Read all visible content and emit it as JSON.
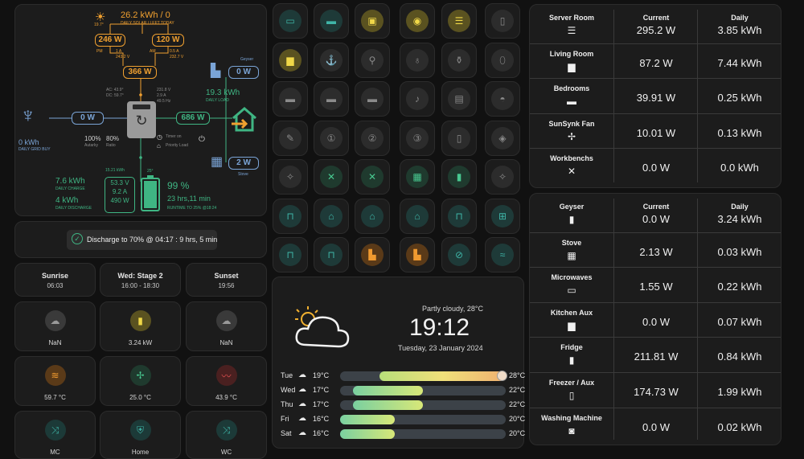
{
  "flow": {
    "solar": {
      "total": "26.2 kWh / 0",
      "caption": "DAILY SOLAR / LEFT TODAY",
      "temp": "19.7°"
    },
    "pv_pm": {
      "power": "246 W",
      "label": "PM",
      "amps": "1 A",
      "volts": "243.2 V"
    },
    "pv_am": {
      "power": "120 W",
      "label": "AM",
      "amps": "0.5 A",
      "volts": "232.7 V"
    },
    "pv_total": "366 W",
    "inverter": {
      "ac": "AC: 43.9°",
      "dc": "DC: 59.7°",
      "volts": "231.8 V",
      "amps": "2.9 A",
      "freq": "49.5 Hz"
    },
    "grid": {
      "power": "0 W",
      "energy": "0 kWh",
      "caption": "DAILY GRID BUY",
      "autarky_val": "100%",
      "autarky": "Autarky",
      "ratio_val": "80%",
      "ratio": "Ratio"
    },
    "load": {
      "power": "686 W",
      "energy": "19.3 kWh",
      "caption": "DAILY LOAD"
    },
    "geyser": {
      "label": "Geyser",
      "power": "0 W"
    },
    "stove": {
      "label": "Stove",
      "power": "2 W"
    },
    "timer": "Timer on",
    "priority": "Priority Load",
    "battery": {
      "energy_kwh": "15.21 kWh",
      "charge": "7.6 kWh",
      "charge_caption": "DAILY CHARGE",
      "discharge": "4 kWh",
      "discharge_caption": "DAILY DISCHARGE",
      "volts": "53.3 V",
      "amps": "9.2 A",
      "power": "490 W",
      "temp": "25°",
      "soc": "99 %",
      "runtime": "23 hrs,11 min",
      "runtime_caption": "RUNTIME TO 25% @18:24",
      "soc_fraction": 0.99
    }
  },
  "discharge_note": "Discharge to 70% @ 04:17 : 9 hrs, 5 min",
  "sun_tiles": [
    {
      "title": "Sunrise",
      "value": "06:03"
    },
    {
      "title": "Wed: Stage 2",
      "value": "16:00 - 18:30"
    },
    {
      "title": "Sunset",
      "value": "19:56"
    }
  ],
  "sensor_tiles": [
    {
      "label": "NaN",
      "icon": "weather-icon",
      "color": "#3a3a3a",
      "fg": "#9a9a9a",
      "glyph": "☁"
    },
    {
      "label": "3.24 kW",
      "icon": "geyser-icon",
      "color": "#5a5220",
      "fg": "#f0d848",
      "glyph": "▮"
    },
    {
      "label": "NaN",
      "icon": "weather-icon",
      "color": "#3a3a3a",
      "fg": "#9a9a9a",
      "glyph": "☁"
    },
    {
      "label": "59.7 °C",
      "icon": "heater-icon",
      "color": "#5a3a18",
      "fg": "#f09a30",
      "glyph": "≋"
    },
    {
      "label": "25.0 °C",
      "icon": "fan-icon",
      "color": "#1f3a2e",
      "fg": "#48c890",
      "glyph": "✢"
    },
    {
      "label": "43.9 °C",
      "icon": "thermometer-icon",
      "color": "#4a2020",
      "fg": "#e05050",
      "glyph": "〰"
    },
    {
      "label": "MC",
      "icon": "motion-icon",
      "color": "#1c3a38",
      "fg": "#3fb5a8",
      "glyph": "⤨"
    },
    {
      "label": "Home",
      "icon": "shield-home-icon",
      "color": "#1c3a38",
      "fg": "#3fb5a8",
      "glyph": "⛨"
    },
    {
      "label": "WC",
      "icon": "motion-icon",
      "color": "#1c3a38",
      "fg": "#3fb5a8",
      "glyph": "⤨"
    }
  ],
  "buttons": [
    [
      {
        "name": "tv-icon",
        "bg": "#1e3a38",
        "fg": "#3fb5a8",
        "glyph": "▭"
      },
      {
        "name": "soundbar-icon",
        "bg": "#1e3a38",
        "fg": "#3fb5a8",
        "glyph": "▬"
      },
      {
        "name": "laptop-icon",
        "bg": "#5a5220",
        "fg": "#f0d848",
        "glyph": "▣"
      },
      {
        "name": "speaker-icon",
        "bg": "#5a5220",
        "fg": "#f0d848",
        "glyph": "◉"
      },
      {
        "name": "server-icon",
        "bg": "#5a5220",
        "fg": "#f0d848",
        "glyph": "☰"
      },
      {
        "name": "phone-icon",
        "bg": "#2c2c2c",
        "fg": "#8a8a8a",
        "glyph": "▯"
      }
    ],
    [
      {
        "name": "sofa-icon",
        "bg": "#5a5220",
        "fg": "#f0d848",
        "glyph": "▆"
      },
      {
        "name": "ceiling-light-icon",
        "bg": "#2c2c2c",
        "fg": "#8a8a8a",
        "glyph": "⚓"
      },
      {
        "name": "lamp-icon",
        "bg": "#2c2c2c",
        "fg": "#8a8a8a",
        "glyph": "⚲"
      },
      {
        "name": "pendant-light-icon",
        "bg": "#2c2c2c",
        "fg": "#8a8a8a",
        "glyph": "♁"
      },
      {
        "name": "lamp-icon",
        "bg": "#2c2c2c",
        "fg": "#8a8a8a",
        "glyph": "⚱"
      },
      {
        "name": "capsule-light-icon",
        "bg": "#2c2c2c",
        "fg": "#8a8a8a",
        "glyph": "⬯"
      }
    ],
    [
      {
        "name": "bed-icon",
        "bg": "#2c2c2c",
        "fg": "#8a8a8a",
        "glyph": "▬"
      },
      {
        "name": "bed-icon",
        "bg": "#2c2c2c",
        "fg": "#8a8a8a",
        "glyph": "▬"
      },
      {
        "name": "bed-icon",
        "bg": "#2c2c2c",
        "fg": "#8a8a8a",
        "glyph": "▬"
      },
      {
        "name": "bell-icon",
        "bg": "#2c2c2c",
        "fg": "#8a8a8a",
        "glyph": "♪"
      },
      {
        "name": "heater-icon",
        "bg": "#2c2c2c",
        "fg": "#8a8a8a",
        "glyph": "▤"
      },
      {
        "name": "bathtub-icon",
        "bg": "#2c2c2c",
        "fg": "#8a8a8a",
        "glyph": "◓"
      }
    ],
    [
      {
        "name": "light-switch-icon",
        "bg": "#2c2c2c",
        "fg": "#8a8a8a",
        "glyph": "✎"
      },
      {
        "name": "number-1-icon",
        "bg": "#2c2c2c",
        "fg": "#8a8a8a",
        "glyph": "①"
      },
      {
        "name": "number-2-icon",
        "bg": "#2c2c2c",
        "fg": "#8a8a8a",
        "glyph": "②"
      },
      {
        "name": "number-3-icon",
        "bg": "#2c2c2c",
        "fg": "#8a8a8a",
        "glyph": "③"
      },
      {
        "name": "tablet-icon",
        "bg": "#2c2c2c",
        "fg": "#8a8a8a",
        "glyph": "▯"
      },
      {
        "name": "alarm-light-icon",
        "bg": "#2c2c2c",
        "fg": "#8a8a8a",
        "glyph": "◈"
      }
    ],
    [
      {
        "name": "lamp-off-icon",
        "bg": "#2c2c2c",
        "fg": "#8a8a8a",
        "glyph": "✧"
      },
      {
        "name": "tools-icon",
        "bg": "#1f3a2e",
        "fg": "#48c890",
        "glyph": "✕"
      },
      {
        "name": "tools-icon",
        "bg": "#1f3a2e",
        "fg": "#48c890",
        "glyph": "✕"
      },
      {
        "name": "calendar-icon",
        "bg": "#1f3a2e",
        "fg": "#48c890",
        "glyph": "▦"
      },
      {
        "name": "fridge-icon",
        "bg": "#1f3a2e",
        "fg": "#48c890",
        "glyph": "▮"
      },
      {
        "name": "lamp-off-icon",
        "bg": "#2c2c2c",
        "fg": "#8a8a8a",
        "glyph": "✧"
      }
    ],
    [
      {
        "name": "door-icon",
        "bg": "#1e3a38",
        "fg": "#3fb5a8",
        "glyph": "⊓"
      },
      {
        "name": "garage-icon",
        "bg": "#1e3a38",
        "fg": "#3fb5a8",
        "glyph": "⌂"
      },
      {
        "name": "garage-icon",
        "bg": "#1e3a38",
        "fg": "#3fb5a8",
        "glyph": "⌂"
      },
      {
        "name": "garage-icon",
        "bg": "#1e3a38",
        "fg": "#3fb5a8",
        "glyph": "⌂"
      },
      {
        "name": "door-icon",
        "bg": "#1e3a38",
        "fg": "#3fb5a8",
        "glyph": "⊓"
      },
      {
        "name": "gate-icon",
        "bg": "#1e3a38",
        "fg": "#3fb5a8",
        "glyph": "⊞"
      }
    ],
    [
      {
        "name": "door-icon",
        "bg": "#1e3a38",
        "fg": "#3fb5a8",
        "glyph": "⊓"
      },
      {
        "name": "door-icon",
        "bg": "#1e3a38",
        "fg": "#3fb5a8",
        "glyph": "⊓"
      },
      {
        "name": "door-open-icon",
        "bg": "#5a3a18",
        "fg": "#f09a30",
        "glyph": "▙"
      },
      {
        "name": "door-open-icon",
        "bg": "#5a3a18",
        "fg": "#f09a30",
        "glyph": "▙"
      },
      {
        "name": "bell-off-icon",
        "bg": "#1e3a38",
        "fg": "#3fb5a8",
        "glyph": "⊘"
      },
      {
        "name": "pool-icon",
        "bg": "#1e3a38",
        "fg": "#3fb5a8",
        "glyph": "≈"
      }
    ]
  ],
  "weather": {
    "condition": "Partly cloudy, 28°C",
    "time": "19:12",
    "date": "Tuesday, 23 January 2024",
    "forecast": [
      {
        "day": "Tue",
        "low": "19°C",
        "high": "28°C",
        "start": 0.24,
        "end": 1.0
      },
      {
        "day": "Wed",
        "low": "17°C",
        "high": "22°C",
        "start": 0.08,
        "end": 0.5
      },
      {
        "day": "Thu",
        "low": "17°C",
        "high": "22°C",
        "start": 0.08,
        "end": 0.5
      },
      {
        "day": "Fri",
        "low": "16°C",
        "high": "20°C",
        "start": 0.0,
        "end": 0.33
      },
      {
        "day": "Sat",
        "low": "16°C",
        "high": "20°C",
        "start": 0.0,
        "end": 0.33
      }
    ]
  },
  "table1": {
    "headers": [
      "Current",
      "Daily"
    ],
    "rows": [
      {
        "name": "Server Room",
        "icon": "server-icon",
        "glyph": "☰",
        "current": "295.2 W",
        "daily": "3.85 kWh"
      },
      {
        "name": "Living Room",
        "icon": "sofa-icon",
        "glyph": "▆",
        "current": "87.2 W",
        "daily": "7.44 kWh"
      },
      {
        "name": "Bedrooms",
        "icon": "bed-icon",
        "glyph": "▬",
        "current": "39.91 W",
        "daily": "0.25 kWh"
      },
      {
        "name": "SunSynk Fan",
        "icon": "fan-icon",
        "glyph": "✢",
        "current": "10.01 W",
        "daily": "0.13 kWh"
      },
      {
        "name": "Workbenchs",
        "icon": "tools-icon",
        "glyph": "✕",
        "current": "0.0 W",
        "daily": "0.0 kWh"
      }
    ]
  },
  "table2": {
    "headers": [
      "Current",
      "Daily"
    ],
    "rows": [
      {
        "name": "Geyser",
        "icon": "geyser-icon",
        "glyph": "▮",
        "current": "0.0 W",
        "daily": "3.24 kWh"
      },
      {
        "name": "Stove",
        "icon": "stove-icon",
        "glyph": "▦",
        "current": "2.13 W",
        "daily": "0.03 kWh"
      },
      {
        "name": "Microwaves",
        "icon": "microwave-icon",
        "glyph": "▭",
        "current": "1.55 W",
        "daily": "0.22 kWh"
      },
      {
        "name": "Kitchen Aux",
        "icon": "toaster-icon",
        "glyph": "▆",
        "current": "0.0 W",
        "daily": "0.07 kWh"
      },
      {
        "name": "Fridge",
        "icon": "fridge-icon",
        "glyph": "▮",
        "current": "211.81 W",
        "daily": "0.84 kWh"
      },
      {
        "name": "Freezer / Aux",
        "icon": "freezer-icon",
        "glyph": "▯",
        "current": "174.73 W",
        "daily": "1.99 kWh"
      },
      {
        "name": "Washing Machine",
        "icon": "washing-machine-icon",
        "glyph": "◙",
        "current": "0.0 W",
        "daily": "0.02 kWh"
      }
    ]
  }
}
